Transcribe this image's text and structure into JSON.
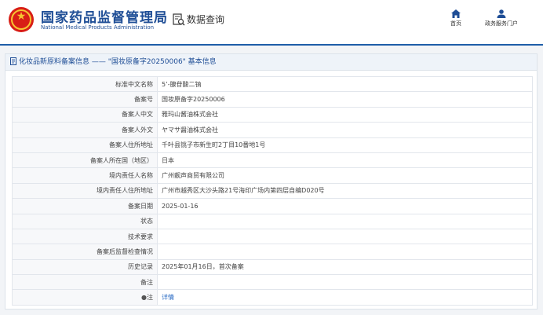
{
  "header": {
    "agency_cn": "国家药品监督管理局",
    "agency_en": "National Medical Products Administration",
    "query_title": "数据查询",
    "nav": {
      "home": "首页",
      "portal": "政务服务门户"
    }
  },
  "panel": {
    "title": "化妆品新原料备案信息 —— \"国妆原备字20250006\" 基本信息"
  },
  "rows": [
    {
      "label": "标准中文名称",
      "value": "5’-腺苷酸二钠"
    },
    {
      "label": "备案号",
      "value": "国妆原备字20250006"
    },
    {
      "label": "备案人中文",
      "value": "雅玛山酱油株式会社"
    },
    {
      "label": "备案人外文",
      "value": "ヤマサ醤油株式会社"
    },
    {
      "label": "备案人住所地址",
      "value": "千叶县铫子市新生町2丁目10番地1号"
    },
    {
      "label": "备案人所在国（地区）",
      "value": "日本"
    },
    {
      "label": "境内责任人名称",
      "value": "广州靓声商贸有限公司"
    },
    {
      "label": "境内责任人住所地址",
      "value": "广州市越秀区大沙头路21号海印广场内第四层自编D020号"
    },
    {
      "label": "备案日期",
      "value": "2025-01-16"
    },
    {
      "label": "状态",
      "value": ""
    },
    {
      "label": "技术要求",
      "value": ""
    },
    {
      "label": "备案后监督检查情况",
      "value": ""
    },
    {
      "label": "历史记录",
      "value": "2025年01月16日，首次备案"
    },
    {
      "label": "备注",
      "value": ""
    }
  ],
  "note_row": {
    "label": "注",
    "link": "详情"
  },
  "colors": {
    "brand_blue": "#1f4e96",
    "link_blue": "#2a6bc4",
    "logo_red": "#d81e16",
    "logo_gold": "#f6c531"
  }
}
